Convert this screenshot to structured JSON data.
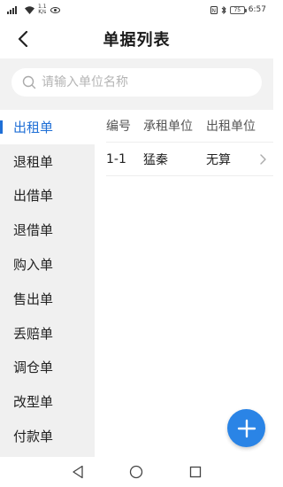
{
  "status_bar": {
    "net_speed": "1.1\nK/s",
    "battery": "75",
    "time": "6:57"
  },
  "header": {
    "title": "单据列表"
  },
  "search": {
    "placeholder": "请输入单位名称"
  },
  "sidebar": {
    "items": [
      {
        "label": "出租单",
        "active": true
      },
      {
        "label": "退租单",
        "active": false
      },
      {
        "label": "出借单",
        "active": false
      },
      {
        "label": "退借单",
        "active": false
      },
      {
        "label": "购入单",
        "active": false
      },
      {
        "label": "售出单",
        "active": false
      },
      {
        "label": "丢赔单",
        "active": false
      },
      {
        "label": "调仓单",
        "active": false
      },
      {
        "label": "改型单",
        "active": false
      },
      {
        "label": "付款单",
        "active": false
      }
    ]
  },
  "table": {
    "columns": [
      "编号",
      "承租单位",
      "出租单位"
    ],
    "rows": [
      {
        "id": "1-1",
        "renter": "猛秦",
        "lessor": "无算"
      }
    ]
  },
  "colors": {
    "accent": "#1f6fd6",
    "fab": "#2a84e6",
    "sidebar_bg": "#f0f0f0",
    "search_bg": "#f2f2f2"
  },
  "icons": {
    "back": "back-arrow-icon",
    "search": "search-icon",
    "row": "chevron-right-icon",
    "fab": "plus-icon",
    "nav_back": "triangle-back-icon",
    "nav_home": "circle-home-icon",
    "nav_recent": "square-recent-icon"
  }
}
